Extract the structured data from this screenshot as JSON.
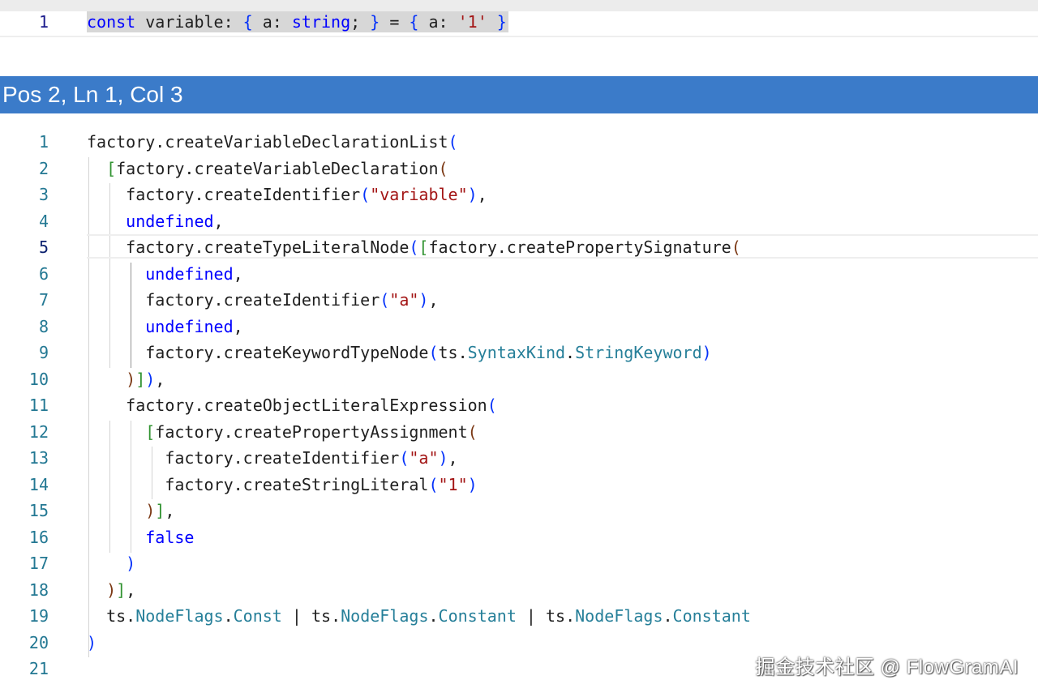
{
  "source_editor": {
    "line_number": "1",
    "tokens": [
      {
        "t": "const",
        "c": "kw"
      },
      {
        "t": " variable: ",
        "c": "plain"
      },
      {
        "t": "{",
        "c": "b1"
      },
      {
        "t": " a: ",
        "c": "plain"
      },
      {
        "t": "string",
        "c": "kw"
      },
      {
        "t": "; ",
        "c": "plain"
      },
      {
        "t": "}",
        "c": "b1"
      },
      {
        "t": " = ",
        "c": "plain"
      },
      {
        "t": "{",
        "c": "b1"
      },
      {
        "t": " a: ",
        "c": "plain"
      },
      {
        "t": "'1'",
        "c": "str"
      },
      {
        "t": " ",
        "c": "plain"
      },
      {
        "t": "}",
        "c": "b1"
      }
    ]
  },
  "status_bar": {
    "text": "Pos 2, Ln 1, Col 3"
  },
  "output_editor": {
    "current_line": 5,
    "lines": [
      {
        "n": "1",
        "tokens": [
          {
            "t": "factory.createVariableDeclarationList",
            "c": "plain"
          },
          {
            "t": "(",
            "c": "b1"
          }
        ]
      },
      {
        "n": "2",
        "tokens": [
          {
            "t": "  ",
            "c": "plain"
          },
          {
            "t": "[",
            "c": "b2"
          },
          {
            "t": "factory.createVariableDeclaration",
            "c": "plain"
          },
          {
            "t": "(",
            "c": "b3"
          }
        ]
      },
      {
        "n": "3",
        "tokens": [
          {
            "t": "    factory.createIdentifier",
            "c": "plain"
          },
          {
            "t": "(",
            "c": "b1"
          },
          {
            "t": "\"variable\"",
            "c": "str"
          },
          {
            "t": ")",
            "c": "b1"
          },
          {
            "t": ",",
            "c": "plain"
          }
        ]
      },
      {
        "n": "4",
        "tokens": [
          {
            "t": "    ",
            "c": "plain"
          },
          {
            "t": "undefined",
            "c": "kw"
          },
          {
            "t": ",",
            "c": "plain"
          }
        ]
      },
      {
        "n": "5",
        "tokens": [
          {
            "t": "    factory.createTypeLiteralNode",
            "c": "plain"
          },
          {
            "t": "(",
            "c": "b1"
          },
          {
            "t": "[",
            "c": "b2"
          },
          {
            "t": "factory.createPropertySignature",
            "c": "plain"
          },
          {
            "t": "(",
            "c": "b3"
          }
        ]
      },
      {
        "n": "6",
        "tokens": [
          {
            "t": "      ",
            "c": "plain"
          },
          {
            "t": "undefined",
            "c": "kw"
          },
          {
            "t": ",",
            "c": "plain"
          }
        ]
      },
      {
        "n": "7",
        "tokens": [
          {
            "t": "      factory.createIdentifier",
            "c": "plain"
          },
          {
            "t": "(",
            "c": "b1"
          },
          {
            "t": "\"a\"",
            "c": "str"
          },
          {
            "t": ")",
            "c": "b1"
          },
          {
            "t": ",",
            "c": "plain"
          }
        ]
      },
      {
        "n": "8",
        "tokens": [
          {
            "t": "      ",
            "c": "plain"
          },
          {
            "t": "undefined",
            "c": "kw"
          },
          {
            "t": ",",
            "c": "plain"
          }
        ]
      },
      {
        "n": "9",
        "tokens": [
          {
            "t": "      factory.createKeywordTypeNode",
            "c": "plain"
          },
          {
            "t": "(",
            "c": "b1"
          },
          {
            "t": "ts.",
            "c": "plain"
          },
          {
            "t": "SyntaxKind",
            "c": "type"
          },
          {
            "t": ".",
            "c": "plain"
          },
          {
            "t": "StringKeyword",
            "c": "type"
          },
          {
            "t": ")",
            "c": "b1"
          }
        ]
      },
      {
        "n": "10",
        "tokens": [
          {
            "t": "    ",
            "c": "plain"
          },
          {
            "t": ")",
            "c": "b3"
          },
          {
            "t": "]",
            "c": "b2"
          },
          {
            "t": ")",
            "c": "b1"
          },
          {
            "t": ",",
            "c": "plain"
          }
        ]
      },
      {
        "n": "11",
        "tokens": [
          {
            "t": "    factory.createObjectLiteralExpression",
            "c": "plain"
          },
          {
            "t": "(",
            "c": "b1"
          }
        ]
      },
      {
        "n": "12",
        "tokens": [
          {
            "t": "      ",
            "c": "plain"
          },
          {
            "t": "[",
            "c": "b2"
          },
          {
            "t": "factory.createPropertyAssignment",
            "c": "plain"
          },
          {
            "t": "(",
            "c": "b3"
          }
        ]
      },
      {
        "n": "13",
        "tokens": [
          {
            "t": "        factory.createIdentifier",
            "c": "plain"
          },
          {
            "t": "(",
            "c": "b1"
          },
          {
            "t": "\"a\"",
            "c": "str"
          },
          {
            "t": ")",
            "c": "b1"
          },
          {
            "t": ",",
            "c": "plain"
          }
        ]
      },
      {
        "n": "14",
        "tokens": [
          {
            "t": "        factory.createStringLiteral",
            "c": "plain"
          },
          {
            "t": "(",
            "c": "b1"
          },
          {
            "t": "\"1\"",
            "c": "str"
          },
          {
            "t": ")",
            "c": "b1"
          }
        ]
      },
      {
        "n": "15",
        "tokens": [
          {
            "t": "      ",
            "c": "plain"
          },
          {
            "t": ")",
            "c": "b3"
          },
          {
            "t": "]",
            "c": "b2"
          },
          {
            "t": ",",
            "c": "plain"
          }
        ]
      },
      {
        "n": "16",
        "tokens": [
          {
            "t": "      ",
            "c": "plain"
          },
          {
            "t": "false",
            "c": "kw"
          }
        ]
      },
      {
        "n": "17",
        "tokens": [
          {
            "t": "    ",
            "c": "plain"
          },
          {
            "t": ")",
            "c": "b1"
          }
        ]
      },
      {
        "n": "18",
        "tokens": [
          {
            "t": "  ",
            "c": "plain"
          },
          {
            "t": ")",
            "c": "b3"
          },
          {
            "t": "]",
            "c": "b2"
          },
          {
            "t": ",",
            "c": "plain"
          }
        ]
      },
      {
        "n": "19",
        "tokens": [
          {
            "t": "  ts.",
            "c": "plain"
          },
          {
            "t": "NodeFlags",
            "c": "type"
          },
          {
            "t": ".",
            "c": "plain"
          },
          {
            "t": "Const",
            "c": "type"
          },
          {
            "t": " | ts.",
            "c": "plain"
          },
          {
            "t": "NodeFlags",
            "c": "type"
          },
          {
            "t": ".",
            "c": "plain"
          },
          {
            "t": "Constant",
            "c": "type"
          },
          {
            "t": " | ts.",
            "c": "plain"
          },
          {
            "t": "NodeFlags",
            "c": "type"
          },
          {
            "t": ".",
            "c": "plain"
          },
          {
            "t": "Constant",
            "c": "type"
          }
        ]
      },
      {
        "n": "20",
        "tokens": [
          {
            "t": ")",
            "c": "b1"
          }
        ]
      },
      {
        "n": "21",
        "tokens": []
      }
    ]
  },
  "watermark": {
    "text": "掘金技术社区 @ FlowGramAI"
  },
  "colors": {
    "status_bar_bg": "#3b7bc9",
    "keyword": "#0000ff",
    "string": "#a31515",
    "type": "#267f99",
    "bracket_level_1": "#0431fa",
    "bracket_level_2": "#319331",
    "bracket_level_3": "#7b3814"
  }
}
